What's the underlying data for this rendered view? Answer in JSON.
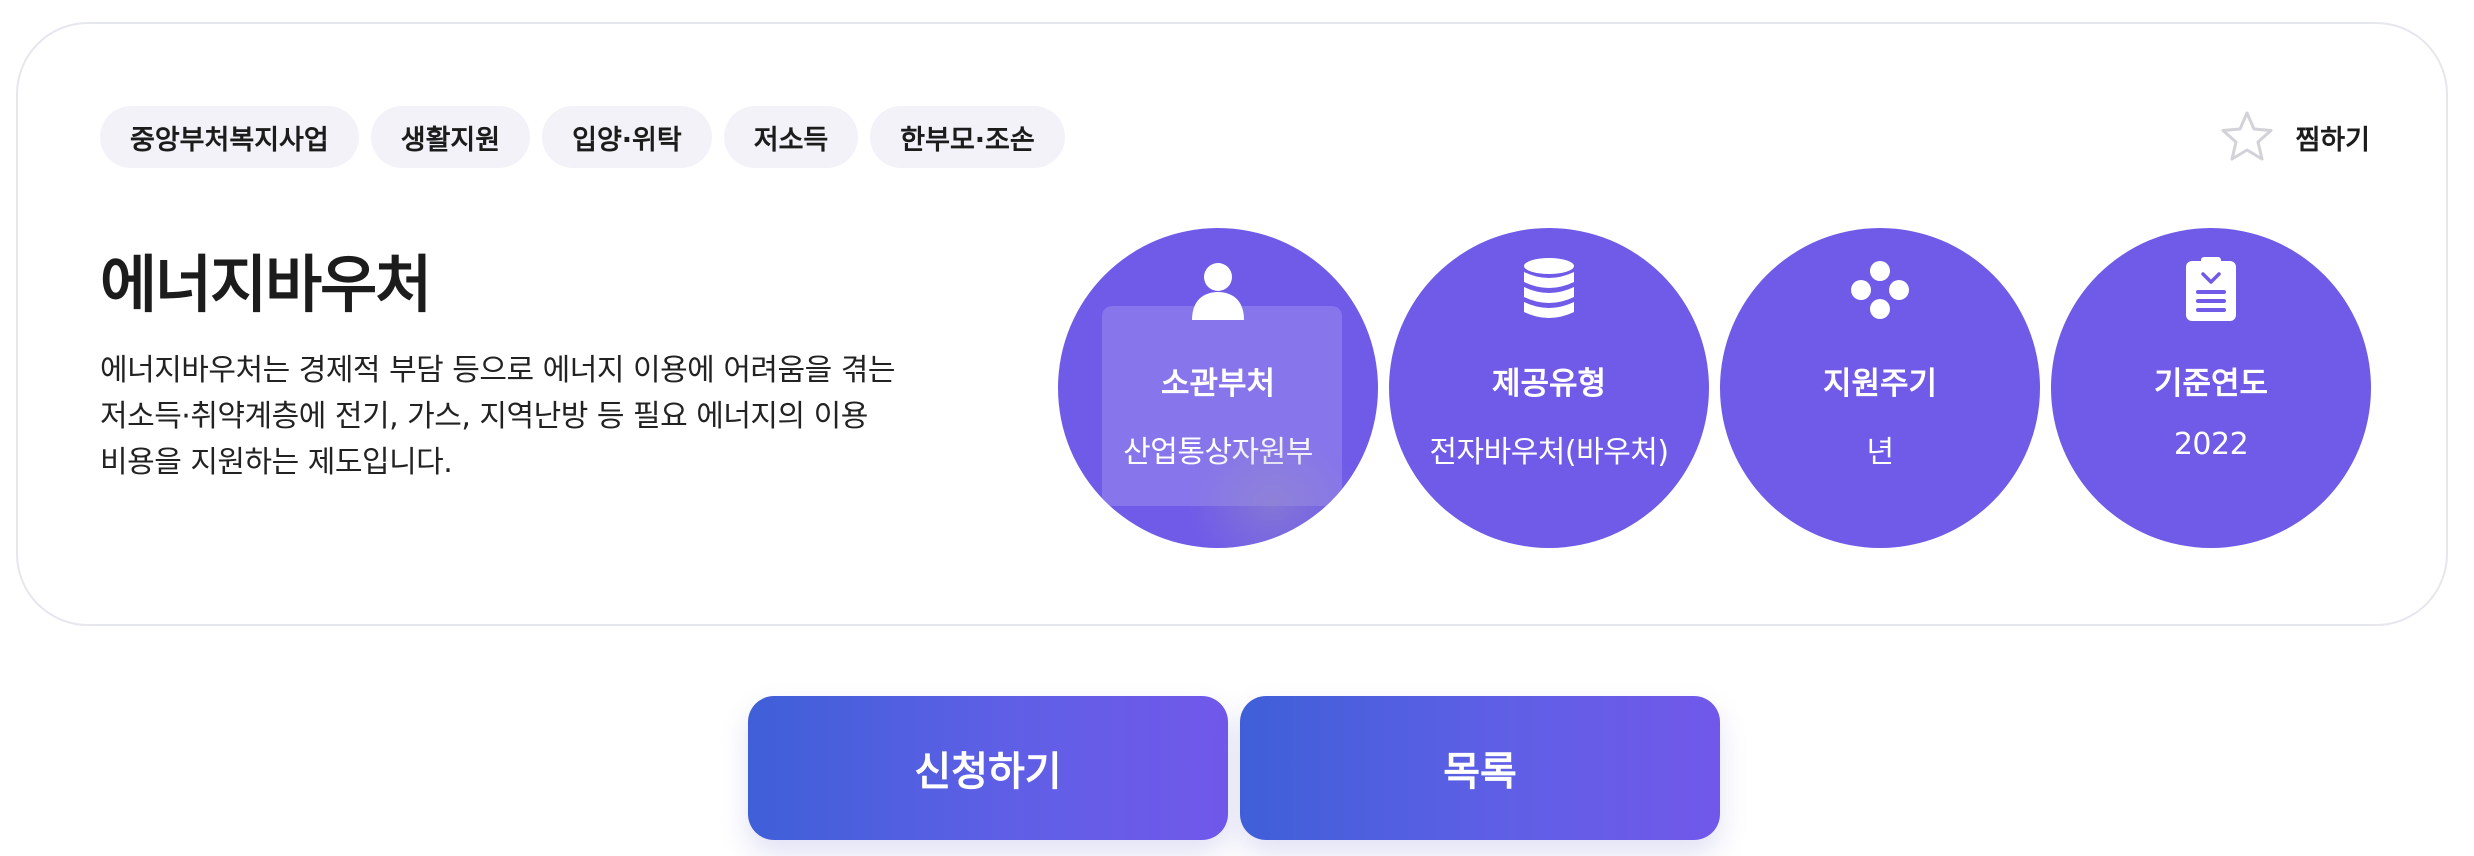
{
  "tags": [
    "중앙부처복지사업",
    "생활지원",
    "입양·위탁",
    "저소득",
    "한부모·조손"
  ],
  "favorite": {
    "label": "찜하기",
    "icon": "star-outline-icon"
  },
  "title": "에너지바우처",
  "description": "에너지바우처는 경제적 부담 등으로 에너지 이용에 어려움을 겪는 저소득·취약계층에 전기, 가스, 지역난방 등 필요 에너지의 이용 비용을 지원하는 제도입니다.",
  "info": [
    {
      "icon": "person-icon",
      "label": "소관부처",
      "value": "산업통상자원부"
    },
    {
      "icon": "database-icon",
      "label": "제공유형",
      "value": "전자바우처(바우처)"
    },
    {
      "icon": "cycle-dots-icon",
      "label": "지원주기",
      "value": "년"
    },
    {
      "icon": "document-icon",
      "label": "기준연도",
      "value": "2022"
    }
  ],
  "buttons": {
    "apply": "신청하기",
    "list": "목록"
  },
  "colors": {
    "accent": "#6f5be8",
    "button_start": "#3f5fd8",
    "button_end": "#7158ea",
    "tag_bg": "#f2f2f8"
  }
}
